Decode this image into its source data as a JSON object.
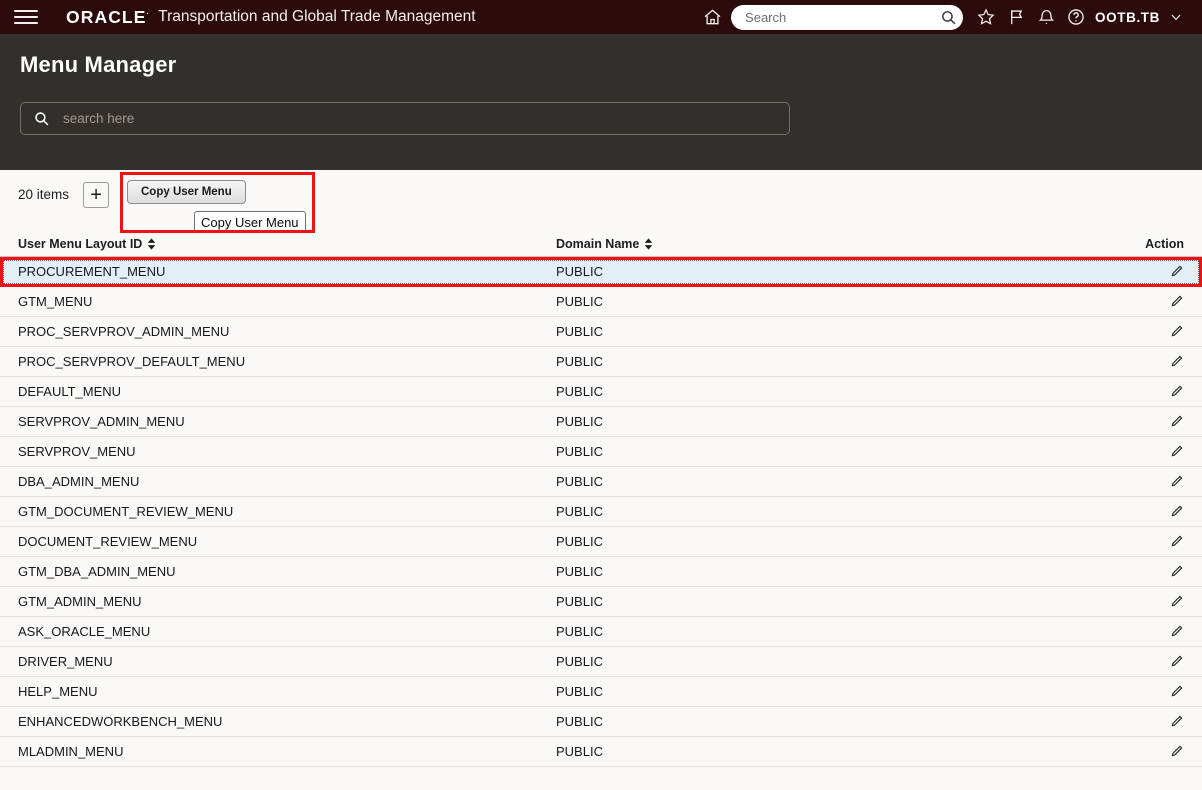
{
  "header": {
    "menu_icon": "hamburger-icon",
    "brand": "ORACLE",
    "brand_mark": "·",
    "app_title": "Transportation and Global Trade Management",
    "home_icon": "home-icon",
    "search_placeholder": "Search",
    "search_value": "",
    "search_icon": "search-icon",
    "favorites_icon": "star-icon",
    "flag_icon": "flag-icon",
    "notifications_icon": "bell-icon",
    "help_icon": "help-icon",
    "user": "OOTB.TB",
    "user_chevron_icon": "chevron-down-icon"
  },
  "banner": {
    "title": "Menu Manager",
    "search_placeholder": "search here",
    "search_value": "",
    "search_icon": "search-icon"
  },
  "toolbar": {
    "item_count": "20 items",
    "add_label": "+",
    "copy_button_label": "Copy User Menu",
    "tooltip_label": "Copy User Menu",
    "highlight_color": "#ee1111"
  },
  "table": {
    "columns": [
      {
        "label": "User Menu Layout ID",
        "sortable": true
      },
      {
        "label": "Domain Name",
        "sortable": true
      },
      {
        "label": "Action",
        "sortable": false
      }
    ],
    "action_icon": "pencil-icon",
    "rows": [
      {
        "id": "PROCUREMENT_MENU",
        "domain": "PUBLIC",
        "selected": true
      },
      {
        "id": "GTM_MENU",
        "domain": "PUBLIC",
        "selected": false
      },
      {
        "id": "PROC_SERVPROV_ADMIN_MENU",
        "domain": "PUBLIC",
        "selected": false
      },
      {
        "id": "PROC_SERVPROV_DEFAULT_MENU",
        "domain": "PUBLIC",
        "selected": false
      },
      {
        "id": "DEFAULT_MENU",
        "domain": "PUBLIC",
        "selected": false
      },
      {
        "id": "SERVPROV_ADMIN_MENU",
        "domain": "PUBLIC",
        "selected": false
      },
      {
        "id": "SERVPROV_MENU",
        "domain": "PUBLIC",
        "selected": false
      },
      {
        "id": "DBA_ADMIN_MENU",
        "domain": "PUBLIC",
        "selected": false
      },
      {
        "id": "GTM_DOCUMENT_REVIEW_MENU",
        "domain": "PUBLIC",
        "selected": false
      },
      {
        "id": "DOCUMENT_REVIEW_MENU",
        "domain": "PUBLIC",
        "selected": false
      },
      {
        "id": "GTM_DBA_ADMIN_MENU",
        "domain": "PUBLIC",
        "selected": false
      },
      {
        "id": "GTM_ADMIN_MENU",
        "domain": "PUBLIC",
        "selected": false
      },
      {
        "id": "ASK_ORACLE_MENU",
        "domain": "PUBLIC",
        "selected": false
      },
      {
        "id": "DRIVER_MENU",
        "domain": "PUBLIC",
        "selected": false
      },
      {
        "id": "HELP_MENU",
        "domain": "PUBLIC",
        "selected": false
      },
      {
        "id": "ENHANCEDWORKBENCH_MENU",
        "domain": "PUBLIC",
        "selected": false
      },
      {
        "id": "MLADMIN_MENU",
        "domain": "PUBLIC",
        "selected": false
      }
    ]
  },
  "colors": {
    "header_bg": "#2b0b0b",
    "banner_bg": "#332f2c",
    "content_bg": "#faf9f8",
    "selected_row_bg": "#e3eff7",
    "highlight_red": "#ee1111"
  }
}
